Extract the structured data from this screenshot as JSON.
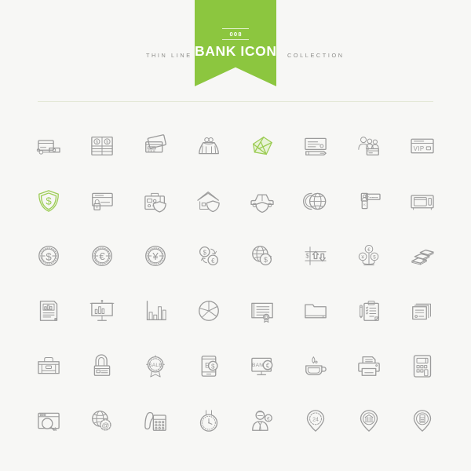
{
  "page": {
    "background_color": "#f7f7f5",
    "accent_color": "#8cc63f",
    "line_color": "#9b9b9b",
    "divider_color": "#e2e7d4"
  },
  "header": {
    "ribbon_number": "008",
    "title": "BANK ICONS",
    "label_left": "THIN LINE",
    "label_right": "COLLECTION"
  },
  "grid": {
    "columns": 8,
    "rows": 6,
    "icons": [
      {
        "name": "card-payment-terminal-icon",
        "label": "Card payment",
        "accent": false
      },
      {
        "name": "banknote-stack-icon",
        "label": "Banknotes",
        "accent": false
      },
      {
        "name": "credit-cards-icon",
        "label": "Credit cards",
        "accent": false
      },
      {
        "name": "money-purse-icon",
        "label": "Money purse",
        "accent": false
      },
      {
        "name": "diamond-gem-icon",
        "label": "Diamond",
        "accent": true
      },
      {
        "name": "cheque-pen-icon",
        "label": "Cheque",
        "accent": false
      },
      {
        "name": "bank-staff-icon",
        "label": "Bank staff",
        "accent": false
      },
      {
        "name": "vip-card-icon",
        "label": "VIP card",
        "accent": false
      },
      {
        "name": "dollar-shield-icon",
        "label": "Money protection",
        "accent": true
      },
      {
        "name": "card-lock-icon",
        "label": "Card security",
        "accent": false
      },
      {
        "name": "travel-insurance-icon",
        "label": "Travel insurance",
        "accent": false
      },
      {
        "name": "home-insurance-icon",
        "label": "Home insurance",
        "accent": false
      },
      {
        "name": "car-insurance-icon",
        "label": "Car insurance",
        "accent": false
      },
      {
        "name": "vault-door-icon",
        "label": "Vault",
        "accent": false
      },
      {
        "name": "security-keycard-icon",
        "label": "Access control",
        "accent": false
      },
      {
        "name": "safe-box-icon",
        "label": "Safe box",
        "accent": false
      },
      {
        "name": "dollar-coin-icon",
        "label": "Dollar",
        "accent": false,
        "symbol": "$"
      },
      {
        "name": "euro-coin-icon",
        "label": "Euro",
        "accent": false,
        "symbol": "€"
      },
      {
        "name": "yen-coin-icon",
        "label": "Yen",
        "accent": false,
        "symbol": "¥"
      },
      {
        "name": "currency-exchange-icon",
        "label": "Currency exchange",
        "accent": false
      },
      {
        "name": "global-currency-icon",
        "label": "Global currency",
        "accent": false
      },
      {
        "name": "exchange-rate-chart-icon",
        "label": "Exchange rates",
        "accent": false
      },
      {
        "name": "money-tree-icon",
        "label": "Money tree",
        "accent": false
      },
      {
        "name": "gold-bars-icon",
        "label": "Gold bars",
        "accent": false
      },
      {
        "name": "financial-report-icon",
        "label": "Financial report",
        "accent": false
      },
      {
        "name": "presentation-board-icon",
        "label": "Presentation",
        "accent": false
      },
      {
        "name": "bar-chart-icon",
        "label": "Bar chart",
        "accent": false
      },
      {
        "name": "pie-chart-icon",
        "label": "Pie chart",
        "accent": false
      },
      {
        "name": "certificate-icon",
        "label": "Certificate",
        "accent": false
      },
      {
        "name": "folder-icon",
        "label": "Folder",
        "accent": false
      },
      {
        "name": "clipboard-checklist-icon",
        "label": "Checklist",
        "accent": false
      },
      {
        "name": "documents-stack-icon",
        "label": "Documents",
        "accent": false
      },
      {
        "name": "briefcase-icon",
        "label": "Briefcase",
        "accent": false
      },
      {
        "name": "card-padlock-icon",
        "label": "Secure card",
        "accent": false
      },
      {
        "name": "sale-badge-icon",
        "label": "Sale badge",
        "accent": false,
        "symbol": "SALE"
      },
      {
        "name": "mobile-banking-icon",
        "label": "Mobile banking",
        "accent": false
      },
      {
        "name": "online-banking-icon",
        "label": "Online banking",
        "accent": false,
        "symbol": "BANK"
      },
      {
        "name": "coffee-cup-icon",
        "label": "Coffee break",
        "accent": false
      },
      {
        "name": "printer-icon",
        "label": "Printer",
        "accent": false
      },
      {
        "name": "calculator-icon",
        "label": "Calculator",
        "accent": false
      },
      {
        "name": "browser-search-icon",
        "label": "Web search",
        "accent": false
      },
      {
        "name": "global-email-icon",
        "label": "Global email",
        "accent": false,
        "symbol": "@"
      },
      {
        "name": "office-phone-icon",
        "label": "Office phone",
        "accent": false
      },
      {
        "name": "wall-clock-icon",
        "label": "Working hours",
        "accent": false
      },
      {
        "name": "bank-consultant-icon",
        "label": "Consultant",
        "accent": false
      },
      {
        "name": "24h-location-pin-icon",
        "label": "24 hours",
        "accent": false,
        "symbol": "24"
      },
      {
        "name": "bank-location-pin-icon",
        "label": "Bank location",
        "accent": false
      },
      {
        "name": "atm-location-pin-icon",
        "label": "ATM location",
        "accent": false
      }
    ]
  }
}
